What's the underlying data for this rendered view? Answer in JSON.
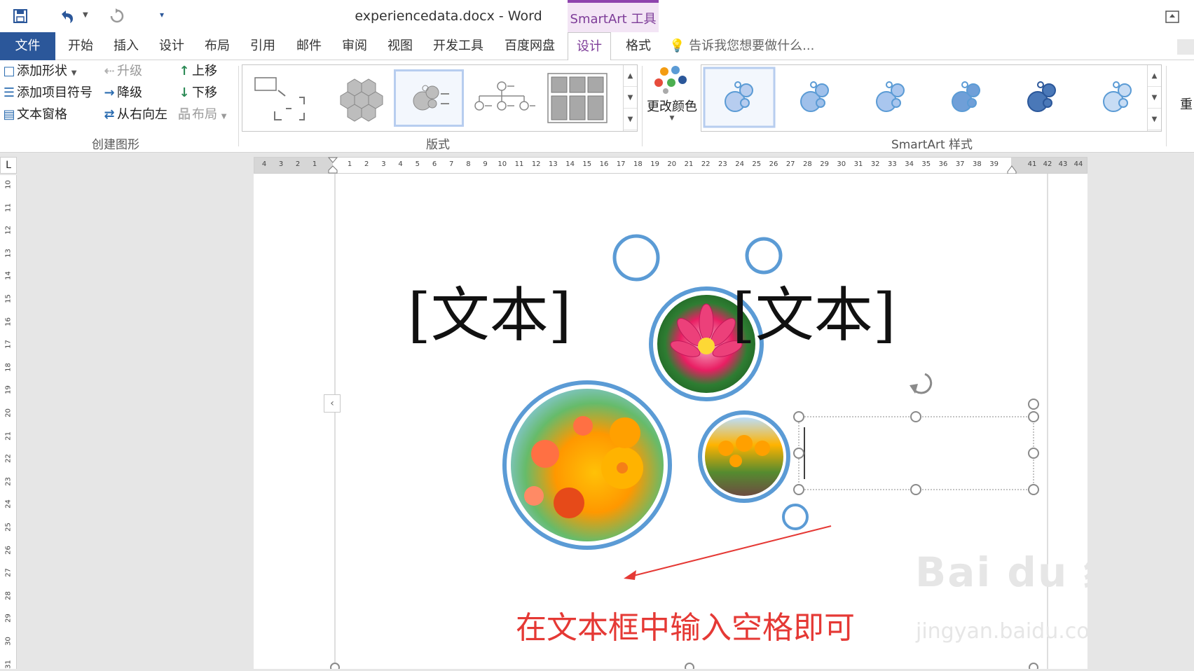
{
  "window": {
    "title": "experiencedata.docx - Word",
    "contextual_tab": "SmartArt 工具"
  },
  "tabs": [
    {
      "label": "文件"
    },
    {
      "label": "开始"
    },
    {
      "label": "插入"
    },
    {
      "label": "设计"
    },
    {
      "label": "布局"
    },
    {
      "label": "引用"
    },
    {
      "label": "邮件"
    },
    {
      "label": "审阅"
    },
    {
      "label": "视图"
    },
    {
      "label": "开发工具"
    },
    {
      "label": "百度网盘"
    },
    {
      "label": "设计"
    },
    {
      "label": "格式"
    }
  ],
  "tell_me": "告诉我您想要做什么...",
  "ribbon": {
    "create_graphic": {
      "label": "创建图形",
      "add_shape": "添加形状",
      "add_bullet": "添加项目符号",
      "text_pane": "文本窗格",
      "promote": "升级",
      "demote": "降级",
      "right_to_left": "从右向左",
      "move_up": "上移",
      "move_down": "下移",
      "layout": "布局"
    },
    "layouts": {
      "label": "版式"
    },
    "change_colors": "更改颜色",
    "smartart_styles": {
      "label": "SmartArt 样式"
    },
    "reset": "重"
  },
  "ruler": {
    "h_left": [
      "4",
      "3",
      "2",
      "1"
    ],
    "h_right": [
      "1",
      "2",
      "3",
      "4",
      "5",
      "6",
      "7",
      "8",
      "9",
      "10",
      "11",
      "12",
      "13",
      "14",
      "15",
      "16",
      "17",
      "18",
      "19",
      "20",
      "21",
      "22",
      "23",
      "24",
      "25",
      "26",
      "27",
      "28",
      "29",
      "30",
      "31",
      "32",
      "33",
      "34",
      "35",
      "36",
      "37",
      "38",
      "39"
    ],
    "h_far": [
      "41",
      "42",
      "43",
      "44"
    ],
    "v": [
      "10",
      "11",
      "12",
      "13",
      "14",
      "15",
      "16",
      "17",
      "18",
      "19",
      "20",
      "21",
      "22",
      "23",
      "24",
      "25",
      "26",
      "27",
      "28",
      "29",
      "30",
      "31"
    ]
  },
  "document": {
    "text_left": "[文本]",
    "text_right": "[文本]",
    "note": "在文本框中输入空格即可",
    "watermark": "Bai du 经验",
    "watermark_url": "jingyan.baidu.com"
  },
  "colors": {
    "accent": "#2b579a",
    "smartart_ring": "#5b9bd5",
    "contextual": "#7d3c98",
    "note": "#e53935"
  },
  "icons": [
    "save-icon",
    "undo-icon",
    "redo-icon",
    "customize-icon",
    "ribbon-display-icon",
    "lightbulb-icon"
  ]
}
